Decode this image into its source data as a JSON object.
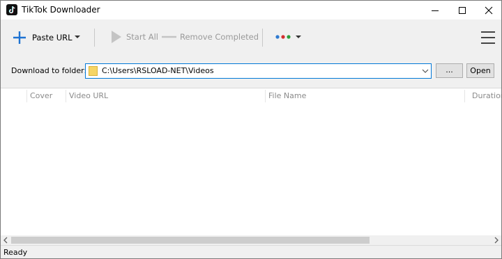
{
  "window": {
    "title": "TikTok Downloader",
    "icon": "tiktok-logo-icon",
    "controls": [
      "minimize-icon",
      "maximize-icon",
      "close-icon"
    ]
  },
  "toolbar": {
    "paste_label": "Paste URL",
    "paste_icon": "plus-icon",
    "start_all_label": "Start All",
    "start_all_icon": "play-icon",
    "remove_completed_label": "Remove Completed",
    "remove_completed_icon": "minus-icon",
    "color_dots": [
      "#2e7ad1",
      "#d32f2f",
      "#2e9e3a"
    ],
    "menu_icon": "hamburger-menu-icon"
  },
  "folder": {
    "label": "Download to folder:",
    "path": "C:\\Users\\RSLOAD-NET\\Videos",
    "browse_label": "...",
    "open_label": "Open"
  },
  "table": {
    "columns": [
      "Cover",
      "Video URL",
      "File Name",
      "Duration"
    ],
    "rows": []
  },
  "status": {
    "text": "Ready"
  },
  "colors": {
    "accent": "#0078d7",
    "toolbar_bg": "#f0f0f0",
    "disabled_text": "#9a9a9a"
  }
}
